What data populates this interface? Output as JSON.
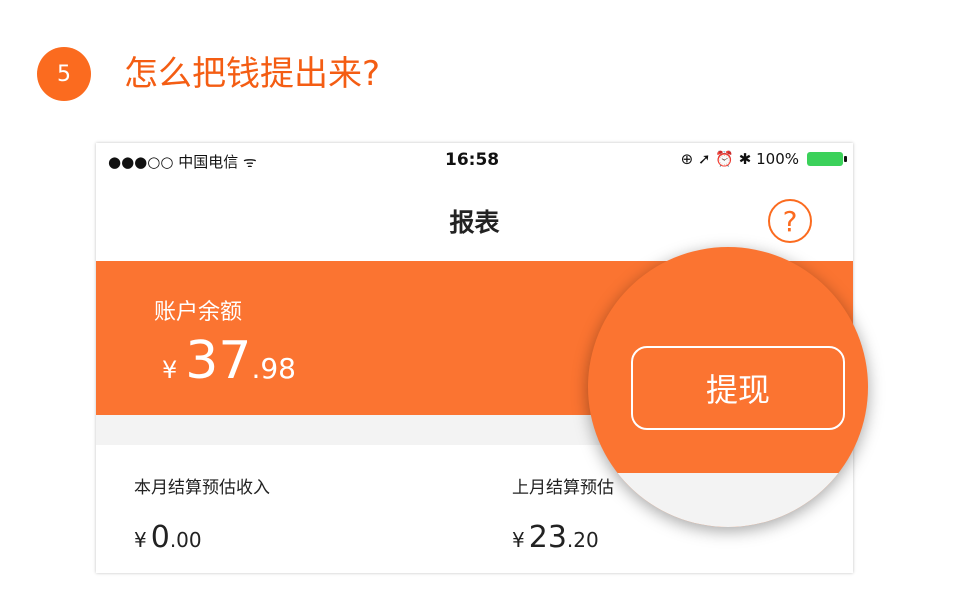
{
  "step": {
    "number": "5",
    "title": "怎么把钱提出来?"
  },
  "statusbar": {
    "carrier": "●●●○○ 中国电信 ᯤ",
    "time": "16:58",
    "right": "⊕ ➚ ⏰ ✱ 100%"
  },
  "nav": {
    "title": "报表",
    "help_icon": "?"
  },
  "balance": {
    "label": "账户余额",
    "currency": "¥",
    "integer": "37",
    "decimal": ".98"
  },
  "withdraw": {
    "label": "提现"
  },
  "stats": [
    {
      "label": "本月结算预估收入",
      "currency": "¥",
      "integer": "0",
      "decimal": ".00"
    },
    {
      "label": "上月结算预估",
      "currency": "¥",
      "integer": "23",
      "decimal": ".20"
    }
  ],
  "colors": {
    "accent": "#fb6b1f",
    "panel": "#fb7431",
    "battery": "#3bd15a"
  }
}
